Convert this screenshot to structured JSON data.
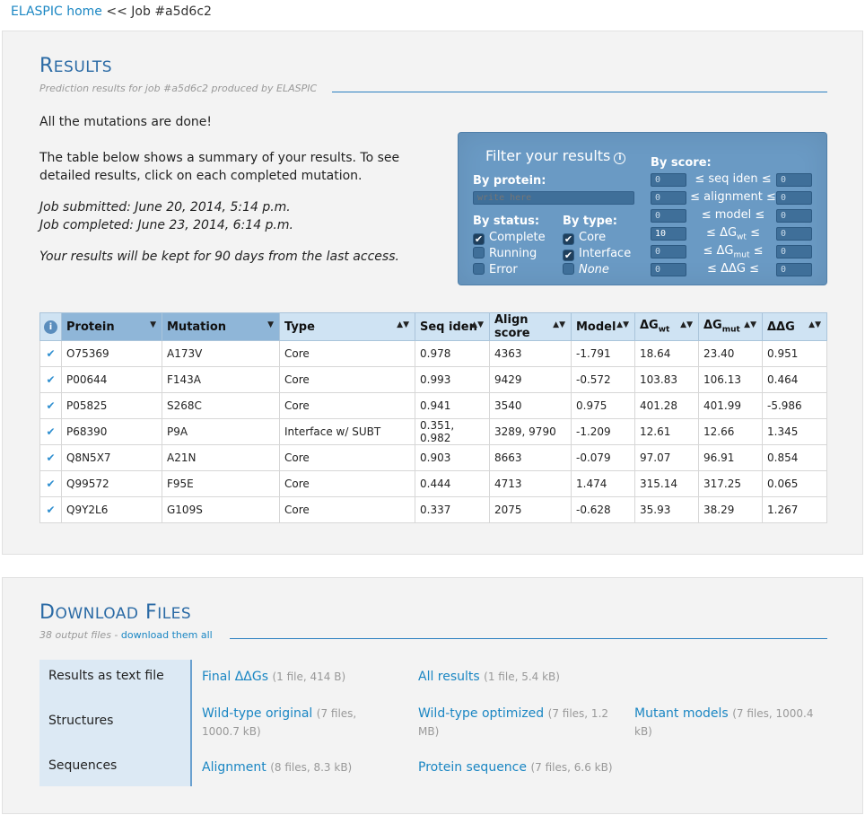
{
  "breadcrumb": {
    "home": "ELASPIC home",
    "sep": "<<",
    "job": "Job #a5d6c2"
  },
  "results": {
    "title_first": "R",
    "title_rest": "esults",
    "subtitle": "Prediction results for job #a5d6c2 produced by ELASPIC",
    "done": "All the mutations are done!",
    "summary": "The table below shows a summary of your results. To see detailed results, click on each completed mutation.",
    "submitted": "Job submitted: June 20, 2014, 5:14 p.m.",
    "completed": "Job completed: June 23, 2014, 6:14 p.m.",
    "retention": "Your results will be kept for 90 days from the last access."
  },
  "filter": {
    "title": "Filter your results",
    "by_protein": "By protein:",
    "protein_placeholder": "write here",
    "by_status": "By status:",
    "statuses": [
      {
        "label": "Complete",
        "checked": true
      },
      {
        "label": "Running",
        "checked": false
      },
      {
        "label": "Error",
        "checked": false
      }
    ],
    "by_type": "By type:",
    "types": [
      {
        "label": "Core",
        "checked": true
      },
      {
        "label": "Interface",
        "checked": true
      },
      {
        "label": "None",
        "checked": false
      }
    ],
    "by_score": "By score:",
    "scores": [
      {
        "label": "seq iden",
        "min": "0",
        "max": "0"
      },
      {
        "label": "alignment",
        "min": "0",
        "max": "0"
      },
      {
        "label": "model",
        "min": "0",
        "max": "0"
      },
      {
        "label": "ΔG",
        "sub": "wt",
        "min": "10",
        "max": "0"
      },
      {
        "label": "ΔG",
        "sub": "mut",
        "min": "0",
        "max": "0"
      },
      {
        "label": "ΔΔG",
        "min": "0",
        "max": "0"
      }
    ],
    "le": "≤"
  },
  "table": {
    "headers": [
      "Protein",
      "Mutation",
      "Type",
      "Seq iden",
      "Align score",
      "Model",
      "ΔG",
      "ΔG",
      "ΔΔG"
    ],
    "header_subs": [
      "",
      "",
      "",
      "",
      "",
      "",
      "wt",
      "mut",
      ""
    ],
    "check": "✔",
    "info": "i",
    "rows": [
      [
        "O75369",
        "A173V",
        "Core",
        "0.978",
        "4363",
        "-1.791",
        "18.64",
        "23.40",
        "0.951"
      ],
      [
        "P00644",
        "F143A",
        "Core",
        "0.993",
        "9429",
        "-0.572",
        "103.83",
        "106.13",
        "0.464"
      ],
      [
        "P05825",
        "S268C",
        "Core",
        "0.941",
        "3540",
        "0.975",
        "401.28",
        "401.99",
        "-5.986"
      ],
      [
        "P68390",
        "P9A",
        "Interface w/ SUBT",
        "0.351, 0.982",
        "3289, 9790",
        "-1.209",
        "12.61",
        "12.66",
        "1.345"
      ],
      [
        "Q8N5X7",
        "A21N",
        "Core",
        "0.903",
        "8663",
        "-0.079",
        "97.07",
        "96.91",
        "0.854"
      ],
      [
        "Q99572",
        "F95E",
        "Core",
        "0.444",
        "4713",
        "1.474",
        "315.14",
        "317.25",
        "0.065"
      ],
      [
        "Q9Y2L6",
        "G109S",
        "Core",
        "0.337",
        "2075",
        "-0.628",
        "35.93",
        "38.29",
        "1.267"
      ]
    ]
  },
  "downloads": {
    "title_first": "D",
    "title_rest": "ownload",
    "title_first2": "F",
    "title_rest2": "iles",
    "count": "38 output files -",
    "download_all": "download them all",
    "row_labels": [
      "Results as text file",
      "Structures",
      "Sequences"
    ],
    "files": [
      {
        "name": "Final ΔΔGs",
        "meta": "(1 file, 414 B)"
      },
      {
        "name": "All results",
        "meta": "(1 file, 5.4 kB)"
      },
      {
        "name": "Wild-type original",
        "meta": "(7 files, 1000.7 kB)"
      },
      {
        "name": "Wild-type optimized",
        "meta": "(7 files, 1.2 MB)"
      },
      {
        "name": "Mutant models",
        "meta": "(7 files, 1000.4 kB)"
      },
      {
        "name": "Alignment",
        "meta": "(8 files, 8.3 kB)"
      },
      {
        "name": "Protein sequence",
        "meta": "(7 files, 6.6 kB)"
      }
    ]
  }
}
